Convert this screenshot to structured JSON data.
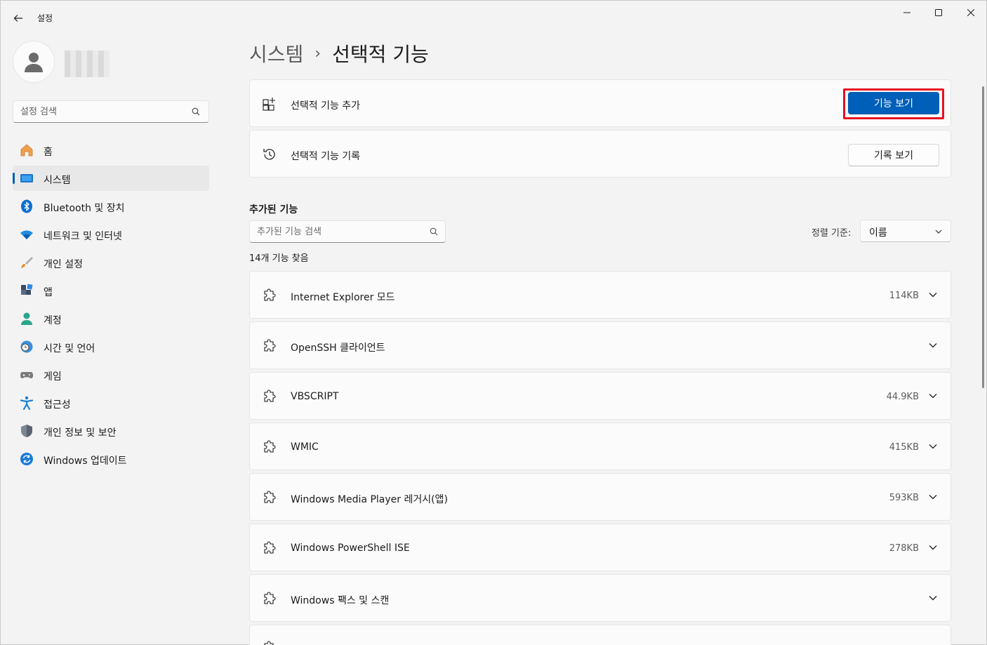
{
  "window": {
    "app_title": "설정"
  },
  "sidebar": {
    "search_placeholder": "설정 검색",
    "items": [
      {
        "label": "홈",
        "icon": "home-icon"
      },
      {
        "label": "시스템",
        "icon": "system-icon",
        "active": true
      },
      {
        "label": "Bluetooth 및 장치",
        "icon": "bluetooth-icon"
      },
      {
        "label": "네트워크 및 인터넷",
        "icon": "wifi-icon"
      },
      {
        "label": "개인 설정",
        "icon": "brush-icon"
      },
      {
        "label": "앱",
        "icon": "apps-icon"
      },
      {
        "label": "계정",
        "icon": "account-icon"
      },
      {
        "label": "시간 및 언어",
        "icon": "clock-globe-icon"
      },
      {
        "label": "게임",
        "icon": "gamepad-icon"
      },
      {
        "label": "접근성",
        "icon": "accessibility-icon"
      },
      {
        "label": "개인 정보 및 보안",
        "icon": "shield-icon"
      },
      {
        "label": "Windows 업데이트",
        "icon": "update-icon"
      }
    ]
  },
  "breadcrumb": {
    "parent": "시스템",
    "separator": "›",
    "current": "선택적 기능"
  },
  "cards": {
    "add": {
      "label": "선택적 기능 추가",
      "button": "기능 보기"
    },
    "history": {
      "label": "선택적 기능 기록",
      "button": "기록 보기"
    }
  },
  "installed": {
    "title": "추가된 기능",
    "search_placeholder": "추가된 기능 검색",
    "sort_label": "정렬 기준:",
    "sort_value": "이름",
    "count_text": "14개 기능 찾음",
    "features": [
      {
        "name": "Internet Explorer 모드",
        "size": "114KB"
      },
      {
        "name": "OpenSSH 클라이언트",
        "size": ""
      },
      {
        "name": "VBSCRIPT",
        "size": "44.9KB"
      },
      {
        "name": "WMIC",
        "size": "415KB"
      },
      {
        "name": "Windows Media Player 레거시(앱)",
        "size": "593KB"
      },
      {
        "name": "Windows PowerShell ISE",
        "size": "278KB"
      },
      {
        "name": "Windows 팩스 및 스캔",
        "size": ""
      }
    ]
  },
  "colors": {
    "accent": "#005fb8",
    "highlight": "#e81123"
  }
}
